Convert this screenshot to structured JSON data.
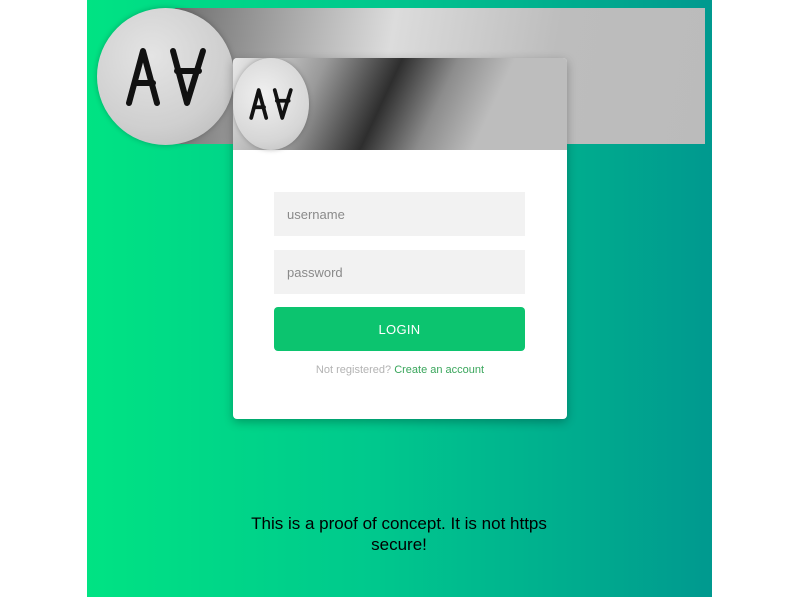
{
  "logo": {
    "icon": "aa-monogram-icon"
  },
  "login_form": {
    "username_placeholder": "username",
    "password_placeholder": "password",
    "login_label": "LOGIN",
    "not_registered_text": "Not registered? ",
    "create_account_link": "Create an account"
  },
  "footer": {
    "note": "This is a proof of concept. It is not https secure!"
  },
  "colors": {
    "gradient_start": "#00e383",
    "gradient_end": "#00998f",
    "login_button": "#0cc46f",
    "link": "#3aa65c"
  }
}
